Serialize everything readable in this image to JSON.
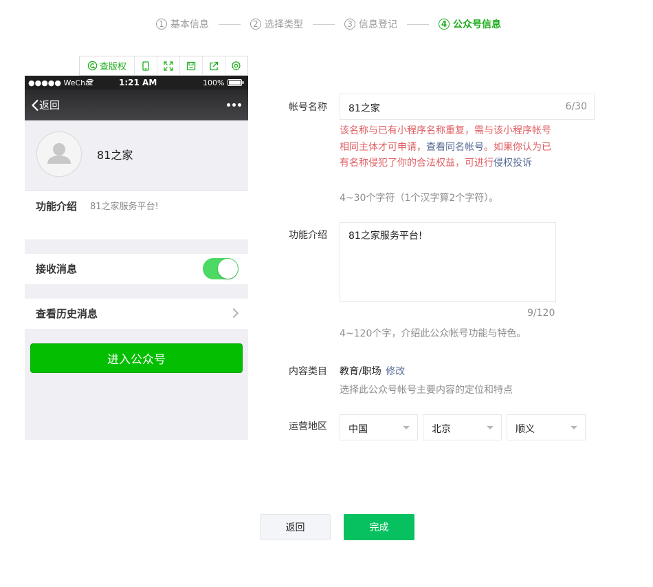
{
  "stepper": {
    "steps": [
      {
        "num": "1",
        "label": "基本信息"
      },
      {
        "num": "2",
        "label": "选择类型"
      },
      {
        "num": "3",
        "label": "信息登记"
      },
      {
        "num": "4",
        "label": "公众号信息"
      }
    ]
  },
  "toolbar": {
    "copyright_label": "查版权",
    "icons": [
      "phone-preview-icon",
      "fullscreen-icon",
      "save-icon",
      "share-icon",
      "settings-icon"
    ]
  },
  "phone": {
    "status": {
      "carrier": "●●●●● WeChat",
      "time": "1:21 AM",
      "battery": "100%"
    },
    "nav": {
      "back_label": "返回"
    },
    "profile": {
      "name": "81之家"
    },
    "intro": {
      "label": "功能介绍",
      "value": "81之家服务平台!"
    },
    "receive": {
      "label": "接收消息",
      "on": true
    },
    "history": {
      "label": "查看历史消息"
    },
    "enter_button": "进入公众号"
  },
  "form": {
    "name": {
      "label": "帐号名称",
      "value": "81之家",
      "count": "6/30",
      "error_text": "该名称与已有小程序名称重复，需与该小程序帐号相同主体才可申请，",
      "error_link1": "查看同名帐号",
      "error_text2": "。如果你认为已有名称侵犯了你的合法权益，可进行",
      "error_link2": "侵权投诉",
      "tip": "4~30个字符（1个汉字算2个字符）。"
    },
    "intro": {
      "label": "功能介绍",
      "value": "81之家服务平台!",
      "count": "9/120",
      "tip": "4~120个字，介绍此公众帐号功能与特色。"
    },
    "category": {
      "label": "内容类目",
      "value": "教育/职场",
      "edit_link": "修改",
      "tip": "选择此公众号帐号主要内容的定位和特点"
    },
    "region": {
      "label": "运营地区",
      "country": "中国",
      "province": "北京",
      "district": "顺义"
    }
  },
  "actions": {
    "back_label": "返回",
    "done_label": "完成"
  },
  "colors": {
    "accent": "#1aad19",
    "error": "#e15f63",
    "link": "#576b95",
    "button_green": "#07c160"
  }
}
